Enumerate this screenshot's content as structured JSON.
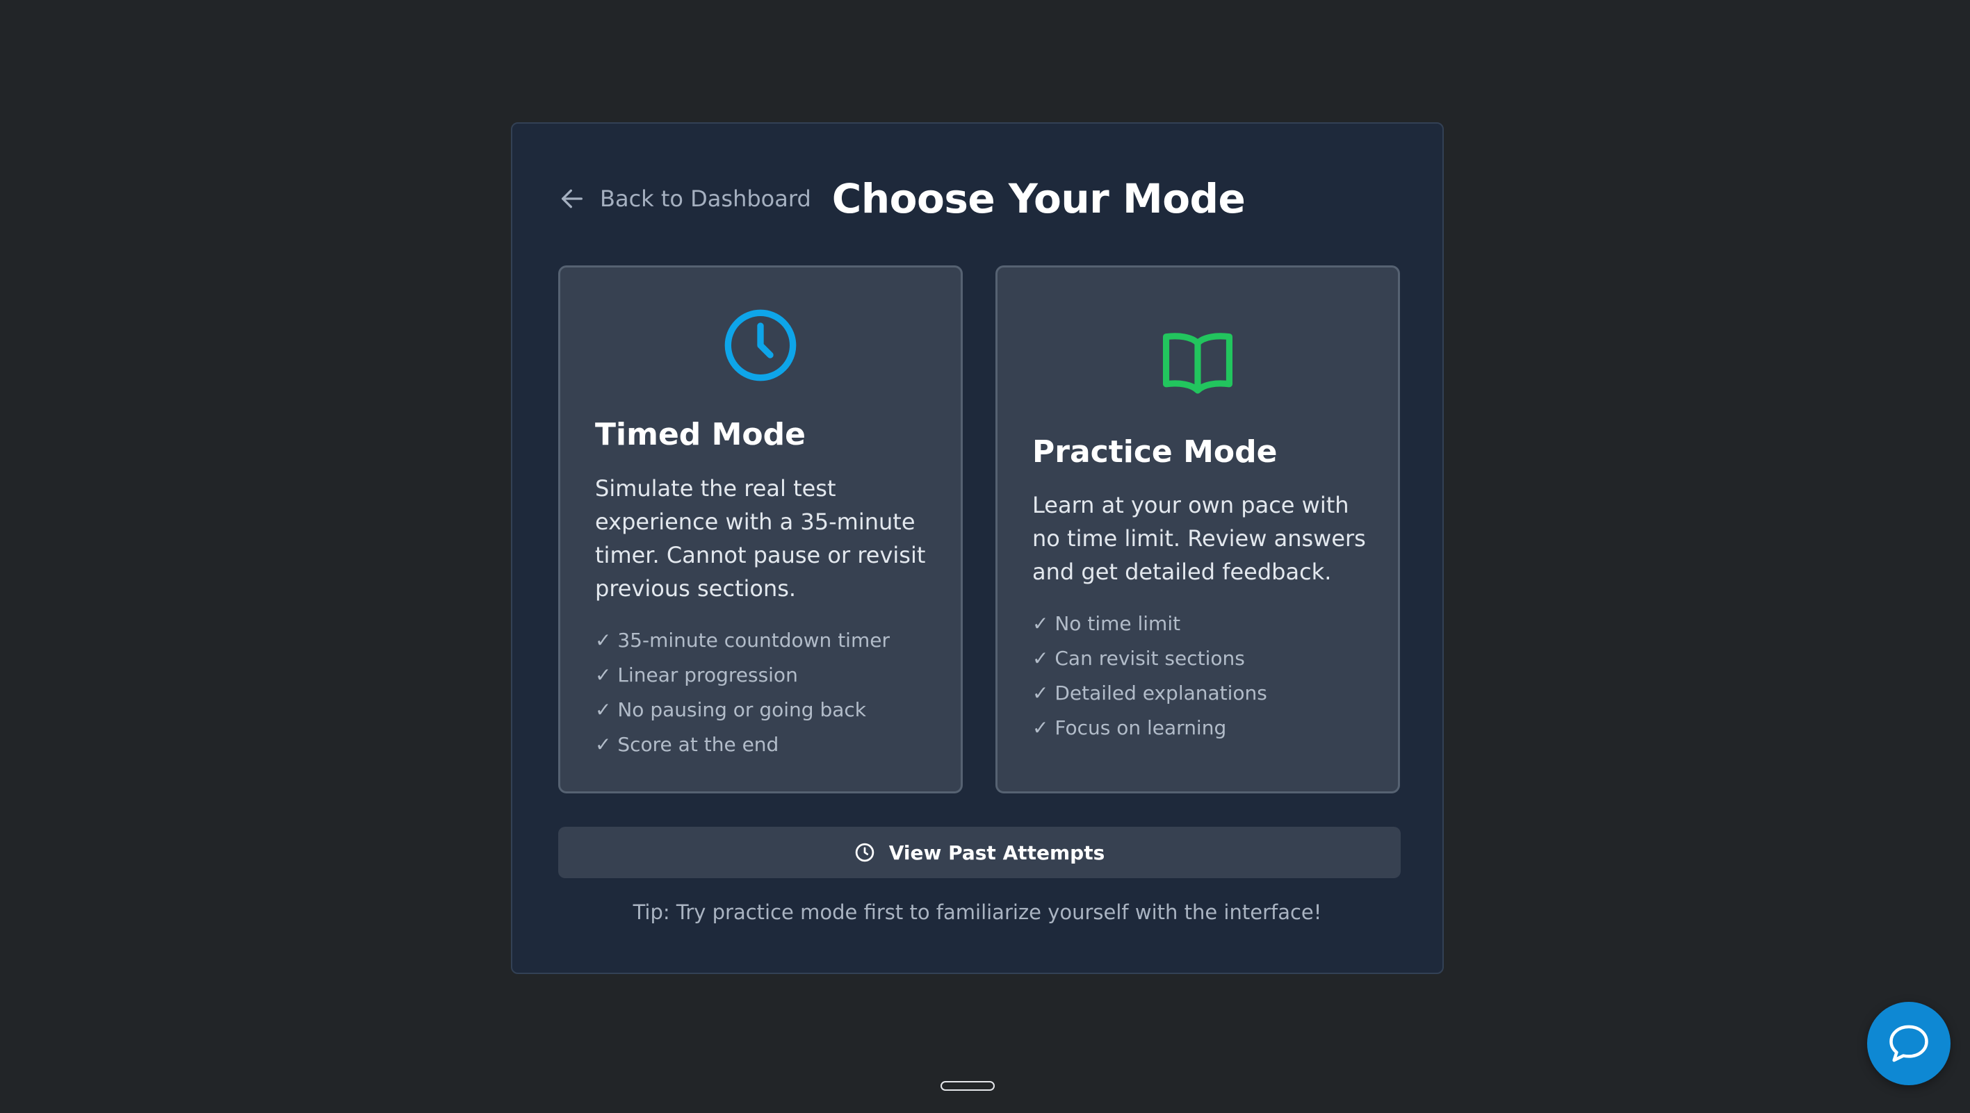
{
  "header": {
    "back_label": "Back to Dashboard",
    "title": "Choose Your Mode"
  },
  "modes": [
    {
      "icon": "clock-icon",
      "title": "Timed Mode",
      "description": "Simulate the real test experience with a 35-minute timer. Cannot pause or revisit previous sections.",
      "features": [
        "✓ 35-minute countdown timer",
        "✓ Linear progression",
        "✓ No pausing or going back",
        "✓ Score at the end"
      ],
      "accent": "#0ea5e9"
    },
    {
      "icon": "book-open-icon",
      "title": "Practice Mode",
      "description": "Learn at your own pace with no time limit. Review answers and get detailed feedback.",
      "features": [
        "✓ No time limit",
        "✓ Can revisit sections",
        "✓ Detailed explanations",
        "✓ Focus on learning"
      ],
      "accent": "#22c55e"
    }
  ],
  "past_attempts_label": "View Past Attempts",
  "tip": "Tip: Try practice mode first to familiarize yourself with the interface!",
  "colors": {
    "background": "#222528",
    "panel": "#1e293b",
    "card": "#374151",
    "chat_button": "#0e88d3"
  }
}
